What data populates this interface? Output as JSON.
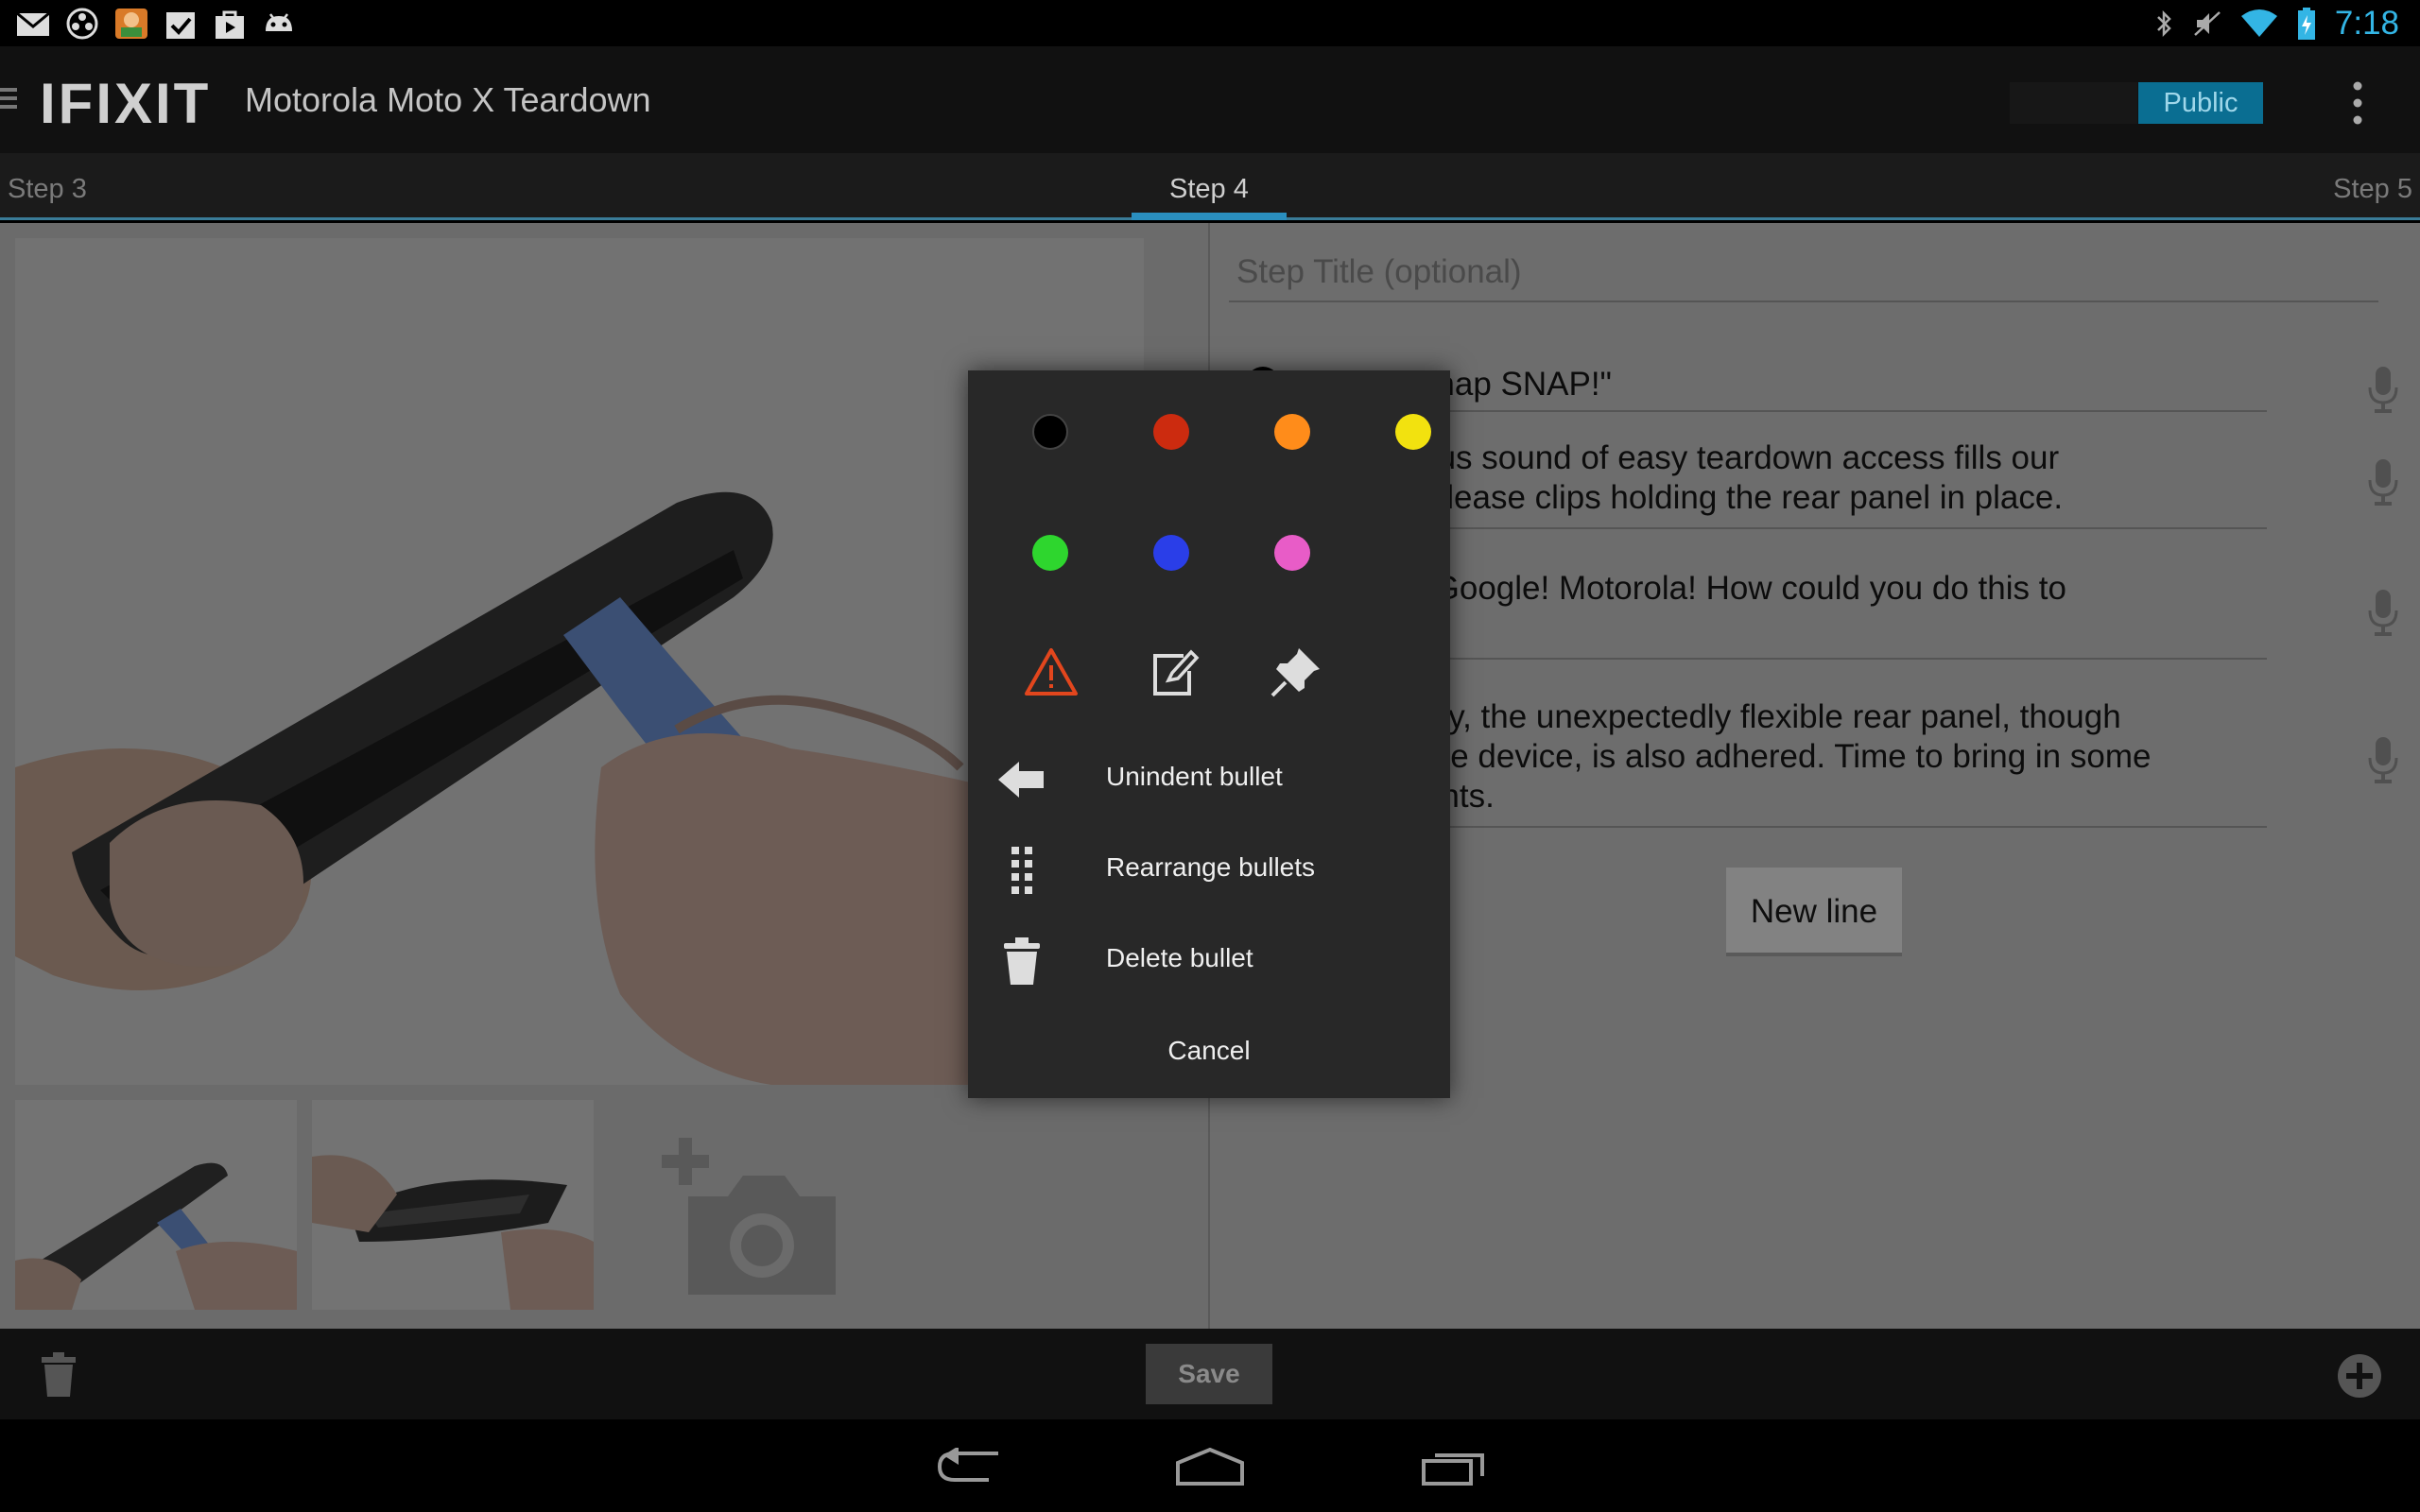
{
  "status_bar": {
    "time": "7:18",
    "left_icons": [
      "gmail-icon",
      "media-icon",
      "game-app-icon",
      "tasks-icon",
      "store-icon",
      "android-icon"
    ],
    "right_icons": [
      "bluetooth-icon",
      "mute-icon",
      "wifi-icon",
      "battery-icon"
    ]
  },
  "action_bar": {
    "logo": "IFIXIT",
    "title": "Motorola Moto X Teardown",
    "public_label": "Public"
  },
  "step_tabs": {
    "prev": "Step 3",
    "current": "Step 4",
    "next": "Step 5"
  },
  "editor": {
    "title_placeholder": "Step Title (optional)",
    "bullets": [
      {
        "text": "\"Snap snap SNAP!\"",
        "color": "#000000"
      },
      {
        "text": "melodious sound of easy teardown access fills our\nas we release clips holding the rear panel in place.",
        "color": "#000000"
      },
      {
        "text": "is this? Google! Motorola! How could you do this to",
        "color": "#000000"
      },
      {
        "text": "ur dismay, the unexpectedly flexible rear panel, though\nped to the device, is also adhered. Time to bring in some\nforcements.",
        "color": "#000000"
      }
    ],
    "new_line_label": "New line"
  },
  "bottom_bar": {
    "save_label": "Save"
  },
  "popup": {
    "colors": [
      {
        "name": "black",
        "hex": "#000000"
      },
      {
        "name": "red",
        "hex": "#cc2b0f"
      },
      {
        "name": "orange",
        "hex": "#ff8c1a"
      },
      {
        "name": "yellow",
        "hex": "#f2e20f"
      },
      {
        "name": "green",
        "hex": "#2ed62e"
      },
      {
        "name": "blue",
        "hex": "#2a3ee8"
      },
      {
        "name": "pink",
        "hex": "#e85cc7"
      }
    ],
    "icons": [
      "warning-icon",
      "note-icon",
      "pin-icon"
    ],
    "items": [
      {
        "label": "Unindent bullet",
        "icon": "arrow-left-icon"
      },
      {
        "label": "Rearrange bullets",
        "icon": "drag-handle-icon"
      },
      {
        "label": "Delete bullet",
        "icon": "trash-icon"
      }
    ],
    "cancel_label": "Cancel"
  }
}
